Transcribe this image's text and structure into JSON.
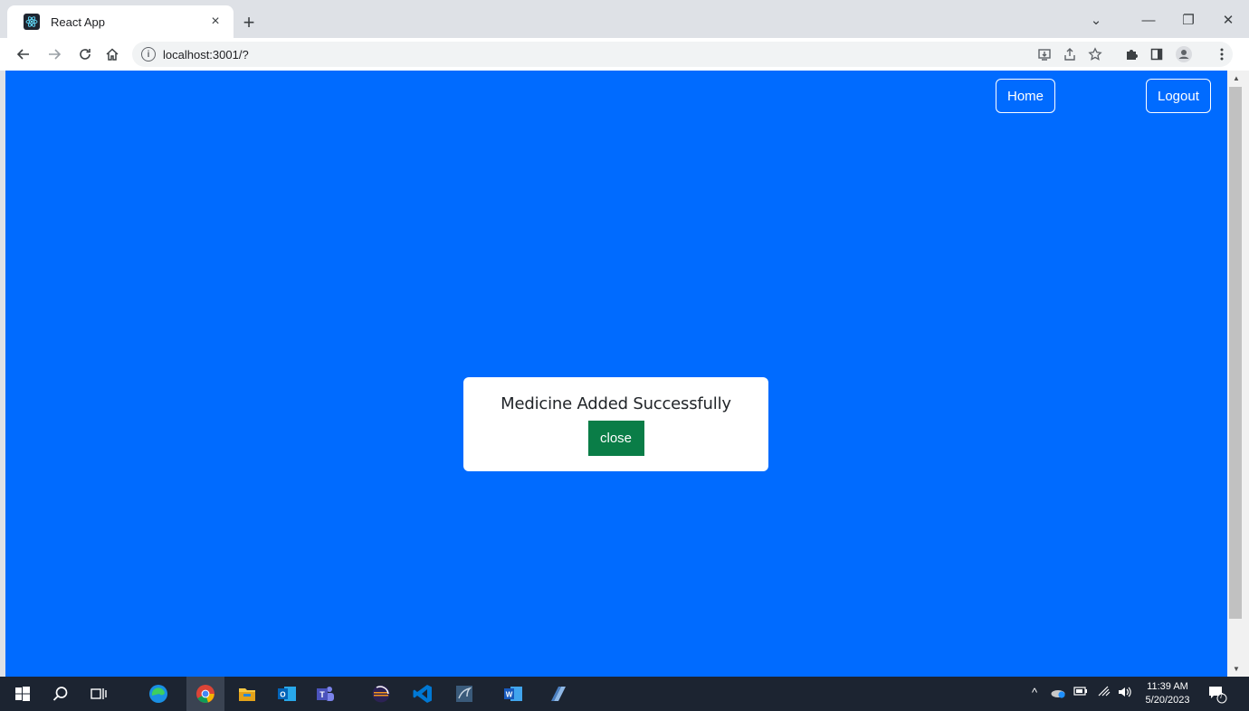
{
  "browser": {
    "tab_title": "React App",
    "tab_close": "×",
    "new_tab": "+",
    "url": "localhost:3001/?",
    "window_controls": {
      "tablist": "⌄",
      "minimize": "—",
      "restore": "❐",
      "close": "✕"
    },
    "toolbar_icons": [
      "back-icon",
      "forward-icon",
      "reload-icon",
      "home-icon"
    ],
    "right_icons": [
      "install-icon",
      "share-icon",
      "bookmark-star-icon",
      "extensions-icon",
      "sidepanel-icon",
      "profile-icon",
      "menu-icon"
    ]
  },
  "page": {
    "background": "#006bff",
    "nav": {
      "home_label": "Home",
      "logout_label": "Logout"
    },
    "modal": {
      "message": "Medicine Added Successfully",
      "close_label": "close",
      "close_color": "#0a7d47"
    }
  },
  "taskbar": {
    "time": "11:39 AM",
    "date": "5/20/2023",
    "notification_count": "7",
    "apps": [
      "windows-start-icon",
      "search-icon",
      "task-view-icon",
      "edge-icon",
      "chrome-icon",
      "file-explorer-icon",
      "outlook-icon",
      "teams-icon",
      "eclipse-icon",
      "vscode-icon",
      "mysql-workbench-icon",
      "word-icon",
      "app-icon"
    ]
  }
}
